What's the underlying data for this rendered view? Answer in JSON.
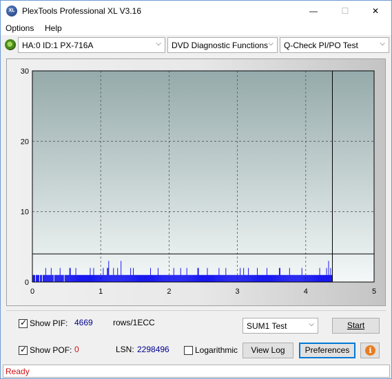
{
  "window": {
    "title": "PlexTools Professional XL V3.16",
    "icon": "xl-icon"
  },
  "titlebar": {
    "minimize": "—",
    "maximize": "☐",
    "close": "✕"
  },
  "menu": [
    {
      "label": "Options"
    },
    {
      "label": "Help"
    }
  ],
  "toolbar": {
    "drive": "HA:0 ID:1  PX-716A",
    "function": "DVD Diagnostic Functions",
    "test": "Q-Check PI/PO Test"
  },
  "chart_data": {
    "type": "bar",
    "xlim": [
      0,
      5
    ],
    "ylim": [
      0,
      30
    ],
    "x_ticks": [
      "0",
      "1",
      "2",
      "3",
      "4",
      "5"
    ],
    "y_ticks": [
      "0",
      "10",
      "20",
      "30"
    ],
    "grid": true,
    "threshold_y": 4,
    "end_marker_x": 4.39,
    "series_color": "#0000ee",
    "pif_samples": [
      1,
      1,
      1,
      1,
      0,
      1,
      1,
      1,
      1,
      1,
      0,
      1,
      1,
      1,
      0,
      1,
      1,
      1,
      1,
      2,
      1,
      1,
      1,
      1,
      1,
      1,
      1,
      2,
      1,
      1,
      1,
      0,
      1,
      1,
      1,
      1,
      1,
      1,
      1,
      1,
      2,
      1,
      1,
      1,
      1,
      1,
      0,
      1,
      1,
      1,
      1,
      1,
      1,
      1,
      2,
      2,
      1,
      1,
      1,
      1,
      1,
      1,
      1,
      2,
      1,
      1,
      1,
      1,
      1,
      1,
      1,
      1,
      1,
      1,
      1,
      1,
      1,
      1,
      1,
      1,
      1,
      1,
      1,
      1,
      2,
      1,
      1,
      1,
      1,
      2,
      1,
      1,
      1,
      1,
      1,
      1,
      1,
      1,
      1,
      1,
      1,
      1,
      1,
      2,
      1,
      1,
      1,
      1,
      1,
      2,
      2,
      3,
      1,
      1,
      1,
      1,
      1,
      1,
      2,
      1,
      1,
      1,
      1,
      1,
      2,
      1,
      1,
      1,
      1,
      3,
      1,
      1,
      1,
      1,
      1,
      1,
      1,
      1,
      1,
      1,
      1,
      1,
      1,
      2,
      1,
      1,
      1,
      2,
      1,
      1,
      1,
      1,
      1,
      1,
      1,
      1,
      1,
      1,
      1,
      1,
      1,
      1,
      1,
      1,
      1,
      1,
      1,
      1,
      1,
      1,
      1,
      1,
      2,
      1,
      1,
      1,
      1,
      1,
      1,
      1,
      1,
      1,
      1,
      2,
      1,
      1,
      1,
      1,
      1,
      1,
      1,
      1,
      1,
      1,
      1,
      1,
      1,
      1,
      1,
      1,
      1,
      1,
      1,
      1,
      1,
      1,
      2,
      1,
      1,
      1,
      1,
      1,
      1,
      1,
      1,
      1,
      2,
      1,
      1,
      1,
      1,
      1,
      1,
      1,
      1,
      2,
      1,
      1,
      1,
      1,
      1,
      1,
      1,
      1,
      1,
      1,
      1,
      1,
      1,
      1,
      1,
      2,
      2,
      1,
      1,
      1,
      1,
      1,
      1,
      1,
      1,
      1,
      1,
      1,
      1,
      2,
      1,
      1,
      1,
      1,
      1,
      1,
      1,
      1,
      1,
      1,
      1,
      1,
      1,
      1,
      1,
      1,
      2,
      1,
      1,
      1,
      1,
      1,
      1,
      1,
      1,
      1,
      2,
      1,
      1,
      1,
      1,
      1,
      1,
      1,
      1,
      1,
      1,
      1,
      1,
      1,
      1,
      1,
      1,
      1,
      1,
      1,
      1,
      2,
      1,
      1,
      1,
      1,
      2,
      1,
      1,
      1,
      1,
      1,
      1,
      2,
      1,
      1,
      1,
      1,
      1,
      1,
      1,
      1,
      1,
      1,
      1,
      1,
      2,
      1,
      1,
      1,
      1,
      1,
      1,
      1,
      1,
      1,
      1,
      1,
      1,
      1,
      2,
      1,
      1,
      1,
      1,
      1,
      1,
      1,
      1,
      1,
      1,
      1,
      1,
      1,
      1,
      1,
      1,
      1,
      2,
      2,
      1,
      1,
      1,
      1,
      1,
      1,
      1,
      1,
      1,
      1,
      1,
      1,
      1,
      2,
      1,
      1,
      1,
      1,
      1,
      1,
      1,
      1,
      1,
      1,
      1,
      1,
      1,
      1,
      1,
      1,
      1,
      2,
      1,
      1,
      1,
      1,
      1,
      1,
      1,
      1,
      1,
      1,
      1,
      1,
      1,
      1,
      1,
      1,
      1,
      1,
      1,
      1,
      1,
      1,
      1,
      1,
      1,
      2,
      1,
      1,
      1,
      1,
      1,
      1,
      1,
      1,
      1,
      2,
      1,
      1,
      3,
      1,
      1,
      2,
      1,
      1
    ]
  },
  "controls": {
    "show_pif_label": "Show PIF:",
    "show_pif_checked": true,
    "pif_value": "4669",
    "pif_unit": "rows/1ECC",
    "show_pof_label": "Show POF:",
    "show_pof_checked": true,
    "pof_value": "0",
    "lsn_label": "LSN:",
    "lsn_value": "2298496",
    "logarithmic_label": "Logarithmic",
    "logarithmic_checked": false,
    "sum_test": "SUM1 Test",
    "start_label": "Start",
    "view_log_label": "View Log",
    "preferences_label": "Preferences"
  },
  "status": {
    "text": "Ready"
  }
}
